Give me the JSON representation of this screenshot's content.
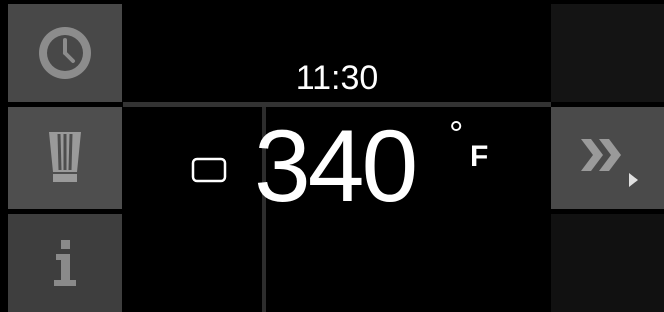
{
  "sidebar": {
    "items": [
      {
        "icon": "clock-icon"
      },
      {
        "icon": "chef-hat-icon"
      },
      {
        "icon": "info-icon"
      }
    ]
  },
  "display": {
    "time": "11:30",
    "temperature": "340",
    "degree_symbol": "°",
    "unit": "F",
    "mode_icon": "oven-mode-icon"
  },
  "next": {
    "icon": "next-chevrons-icon"
  },
  "colors": {
    "background": "#000000",
    "button": "#4a4a4a",
    "icon": "#8a8a8a",
    "text": "#ffffff"
  }
}
